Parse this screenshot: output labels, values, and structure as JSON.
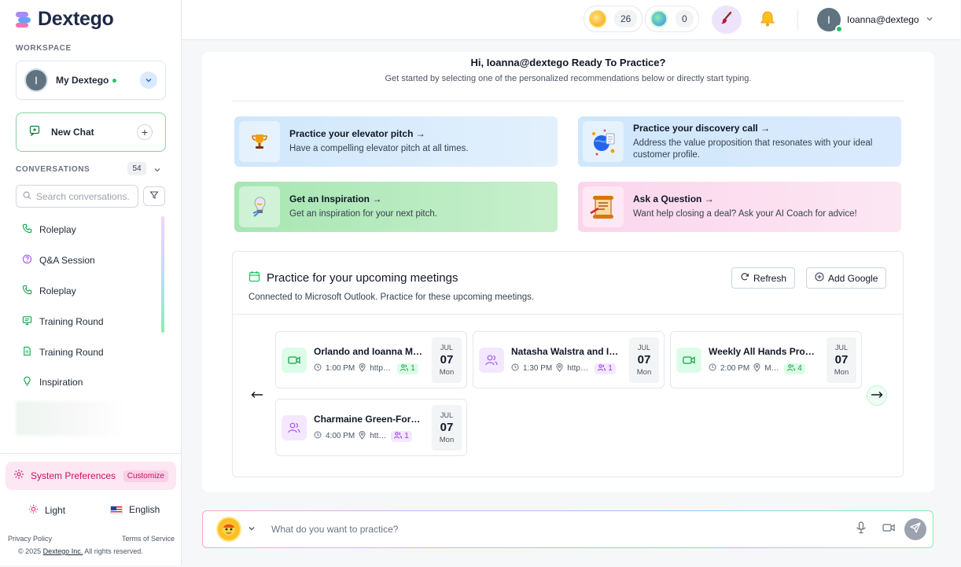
{
  "brand": {
    "name": "Dextego"
  },
  "sidebar": {
    "workspace_label": "WORKSPACE",
    "workspace": {
      "avatar_initial": "I",
      "name": "My Dextego"
    },
    "new_chat_label": "New Chat",
    "conversations_label": "CONVERSATIONS",
    "conversations_count": "54",
    "search_placeholder": "Search conversations...",
    "conversations": [
      {
        "label": "Roleplay",
        "icon": "phone-icon"
      },
      {
        "label": "Q&A Session",
        "icon": "question-circle-icon"
      },
      {
        "label": "Roleplay",
        "icon": "phone-icon"
      },
      {
        "label": "Training Round",
        "icon": "monitor-icon"
      },
      {
        "label": "Training Round",
        "icon": "document-icon"
      },
      {
        "label": "Inspiration",
        "icon": "lightbulb-icon"
      }
    ],
    "system_prefs_label": "System Preferences",
    "customize_label": "Customize",
    "theme_label": "Light",
    "language_label": "English",
    "privacy_label": "Privacy Policy",
    "terms_label": "Terms of Service",
    "copyright_prefix": "© 2025",
    "copyright_company": "Dextego Inc.",
    "copyright_suffix": "All rights reserved."
  },
  "topbar": {
    "coins": "26",
    "gems": "0",
    "user_initial": "I",
    "user_name": "Ioanna@dextego"
  },
  "main": {
    "greeting": "Hi, Ioanna@dextego Ready To Practice?",
    "subtitle": "Get started by selecting one of the personalized recommendations below or directly start typing.",
    "recommendations": [
      {
        "title": "Practice your elevator pitch →",
        "desc": "Have a compelling elevator pitch at all times."
      },
      {
        "title": "Practice your discovery call →",
        "desc": "Address the value proposition that resonates with your ideal customer profile."
      },
      {
        "title": "Get an Inspiration →",
        "desc": "Get an inspiration for your next pitch."
      },
      {
        "title": "Ask a Question →",
        "desc": "Want help closing a deal? Ask your AI Coach for advice!"
      }
    ],
    "meetings_title": "Practice for your upcoming meetings",
    "meetings_subtitle": "Connected to Microsoft Outlook. Practice for these upcoming meetings.",
    "refresh_label": "Refresh",
    "add_google_label": "Add Google",
    "meetings": [
      {
        "name": "Orlando and Ioanna Meeting",
        "time": "1:00 PM",
        "location": "https://teams.microsoft.com",
        "attendees": "1",
        "month": "JUL",
        "day": "07",
        "weekday": "Mon",
        "kind": "video"
      },
      {
        "name": "Natasha Walstra and Ioanna",
        "time": "1:30 PM",
        "location": "https://teams.microsoft.com",
        "attendees": "1",
        "month": "JUL",
        "day": "07",
        "weekday": "Mon",
        "kind": "people"
      },
      {
        "name": "Weekly All Hands Product Sync",
        "time": "2:00 PM",
        "location": "Microsoft Teams",
        "attendees": "4",
        "month": "JUL",
        "day": "07",
        "weekday": "Mon",
        "kind": "video"
      },
      {
        "name": "Charmaine Green-Ford and Ioanna",
        "time": "4:00 PM",
        "location": "https://teams.microsoft.com",
        "attendees": "1",
        "month": "JUL",
        "day": "07",
        "weekday": "Mon",
        "kind": "people"
      }
    ]
  },
  "composer": {
    "placeholder": "What do you want to practice?"
  },
  "colors": {
    "accent_green": "#22c55e",
    "accent_pink": "#be185d",
    "accent_purple": "#a855f7"
  }
}
